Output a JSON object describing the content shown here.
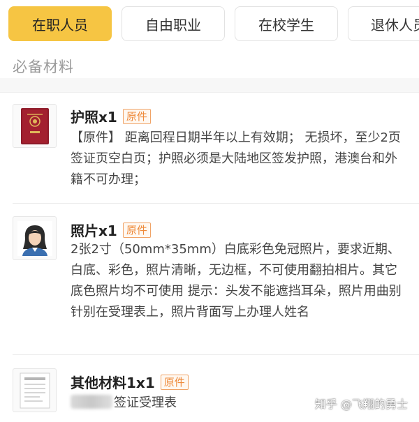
{
  "tabs": [
    {
      "label": "在职人员",
      "active": true
    },
    {
      "label": "自由职业",
      "active": false
    },
    {
      "label": "在校学生",
      "active": false
    },
    {
      "label": "退休人员",
      "active": false
    }
  ],
  "section_title": "必备材料",
  "items": [
    {
      "title": "护照x1",
      "badge": "原件",
      "icon": "passport-icon",
      "description": "【原件】 距离回程日期半年以上有效期； 无损坏，至少2页签证页空白页；护照必须是大陆地区签发护照，港澳台和外籍不可办理；"
    },
    {
      "title": "照片x1",
      "badge": "原件",
      "icon": "portrait-photo-icon",
      "description": "2张2寸（50mm*35mm）白底彩色免冠照片，要求近期、白底、彩色，照片清晰，无边框，不可使用翻拍相片。其它底色照片均不可使用 提示：头发不能遮挡耳朵，照片用曲别针别在受理表上，照片背面写上办理人姓名"
    },
    {
      "title": "其他材料1x1",
      "badge": "原件",
      "icon": "document-icon",
      "description": "签证受理表"
    }
  ],
  "watermark": "知乎 @飞翔的勇士",
  "colors": {
    "active_tab": "#f6c543",
    "badge_border": "#f0a366",
    "badge_text": "#ee8a3a",
    "section_title": "#9a9a9a"
  }
}
